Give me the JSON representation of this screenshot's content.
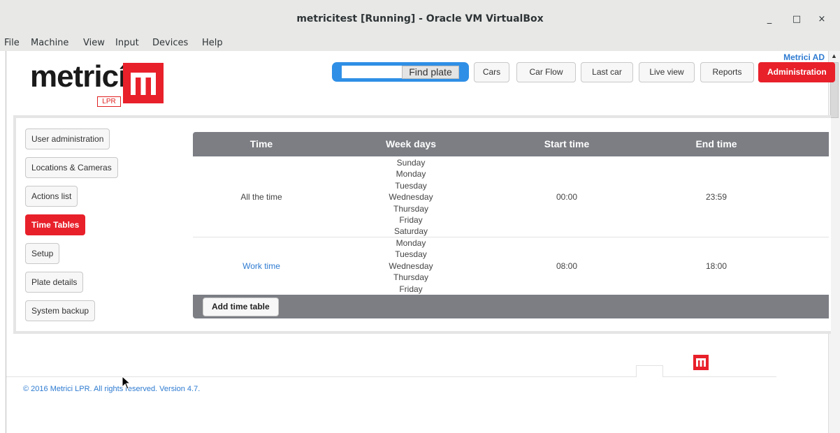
{
  "window": {
    "title": "metricitest [Running] - Oracle VM VirtualBox",
    "minimize": "_",
    "maximize": "□",
    "close": "×"
  },
  "menu": [
    "File",
    "Machine",
    "View",
    "Input",
    "Devices",
    "Help"
  ],
  "app": {
    "user_label": "Metrici AD",
    "logo_text": "metricí",
    "logo_sub": "LPR",
    "search": {
      "value": "",
      "button": "Find plate"
    },
    "nav": [
      "Cars",
      "Car Flow",
      "Last car",
      "Live view",
      "Reports",
      "Administration"
    ],
    "sidebar": [
      "User administration",
      "Locations & Cameras",
      "Actions list",
      "Time Tables",
      "Setup",
      "Plate details",
      "System backup"
    ],
    "table": {
      "headers": [
        "Time",
        "Week days",
        "Start time",
        "End time"
      ],
      "rows": [
        {
          "time": "All the time",
          "days": [
            "Sunday",
            "Monday",
            "Tuesday",
            "Wednesday",
            "Thursday",
            "Friday",
            "Saturday"
          ],
          "start": "00:00",
          "end": "23:59"
        },
        {
          "time": "Work time",
          "days": [
            "Monday",
            "Tuesday",
            "Wednesday",
            "Thursday",
            "Friday"
          ],
          "start": "08:00",
          "end": "18:00"
        }
      ],
      "add_button": "Add time table"
    },
    "footer": {
      "copyright": "© 2016 Metrici LPR. All rights reserved. Version 4.7."
    },
    "colors": {
      "brand_red": "#e8202a",
      "link_blue": "#2e7bd1",
      "header_gray": "#7c7e84",
      "search_blue": "#2f8fe6"
    }
  }
}
